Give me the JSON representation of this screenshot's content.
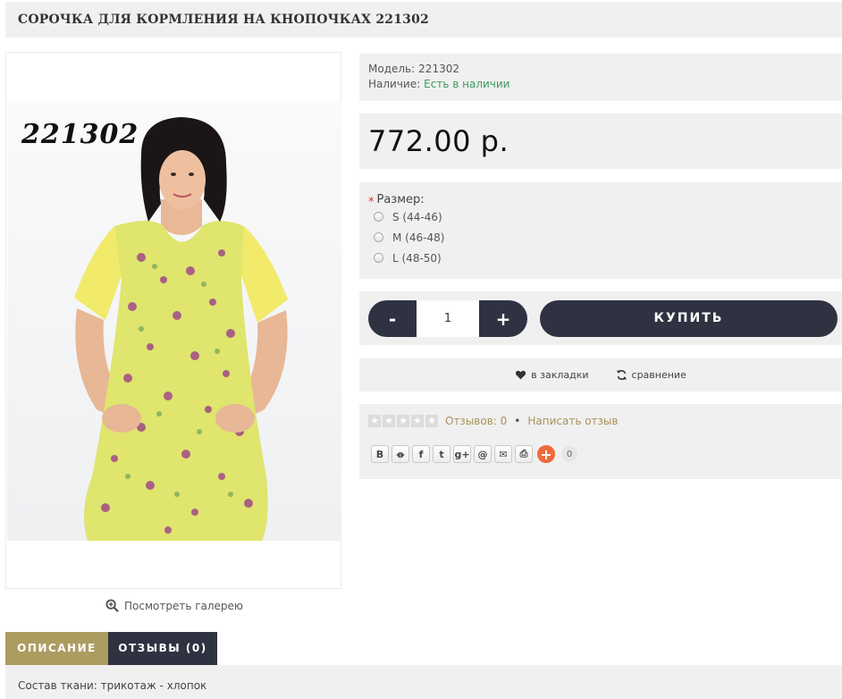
{
  "product": {
    "title": "СОРОЧКА ДЛЯ КОРМЛЕНИЯ НА КНОПОЧКАХ 221302",
    "image_code": "221302",
    "gallery_link": "Посмотреть галерею"
  },
  "info": {
    "model_label": "Модель:",
    "model_value": "221302",
    "stock_label": "Наличие:",
    "stock_value": "Есть в наличии",
    "stock_color": "#3c9a5f"
  },
  "price": "772.00 р.",
  "size": {
    "label": "Размер:",
    "required_mark": "*",
    "options": [
      "S (44-46)",
      "M (46-48)",
      "L (48-50)"
    ]
  },
  "buy": {
    "minus": "-",
    "quantity": "1",
    "plus": "+",
    "buy_label": "КУПИТЬ"
  },
  "links": {
    "bookmark": "в закладки",
    "compare": "сравнение"
  },
  "reviews": {
    "rating_stars": 0,
    "count_text": "Отзывов: 0",
    "separator": "•",
    "write": "Написать отзыв"
  },
  "share": {
    "buttons": [
      {
        "icon": "vk-icon",
        "glyph": "В"
      },
      {
        "icon": "odnoklassniki-icon",
        "glyph": "ꝋ"
      },
      {
        "icon": "facebook-icon",
        "glyph": "f"
      },
      {
        "icon": "twitter-icon",
        "glyph": "t"
      },
      {
        "icon": "google-plus-icon",
        "glyph": "g+"
      },
      {
        "icon": "mail-ru-icon",
        "glyph": "@"
      },
      {
        "icon": "email-icon",
        "glyph": "✉"
      },
      {
        "icon": "print-icon",
        "glyph": "⎙"
      }
    ],
    "more": "+",
    "counter": "0"
  },
  "tabs": [
    {
      "label": "ОПИСАНИЕ",
      "active": true
    },
    {
      "label": "ОТЗЫВЫ (0)",
      "active": false
    }
  ],
  "description": "Состав ткани: трикотаж - хлопок",
  "colors": {
    "dark": "#2f3241",
    "accent_gold": "#ac9c60",
    "panel_bg": "#f0f0f0"
  }
}
